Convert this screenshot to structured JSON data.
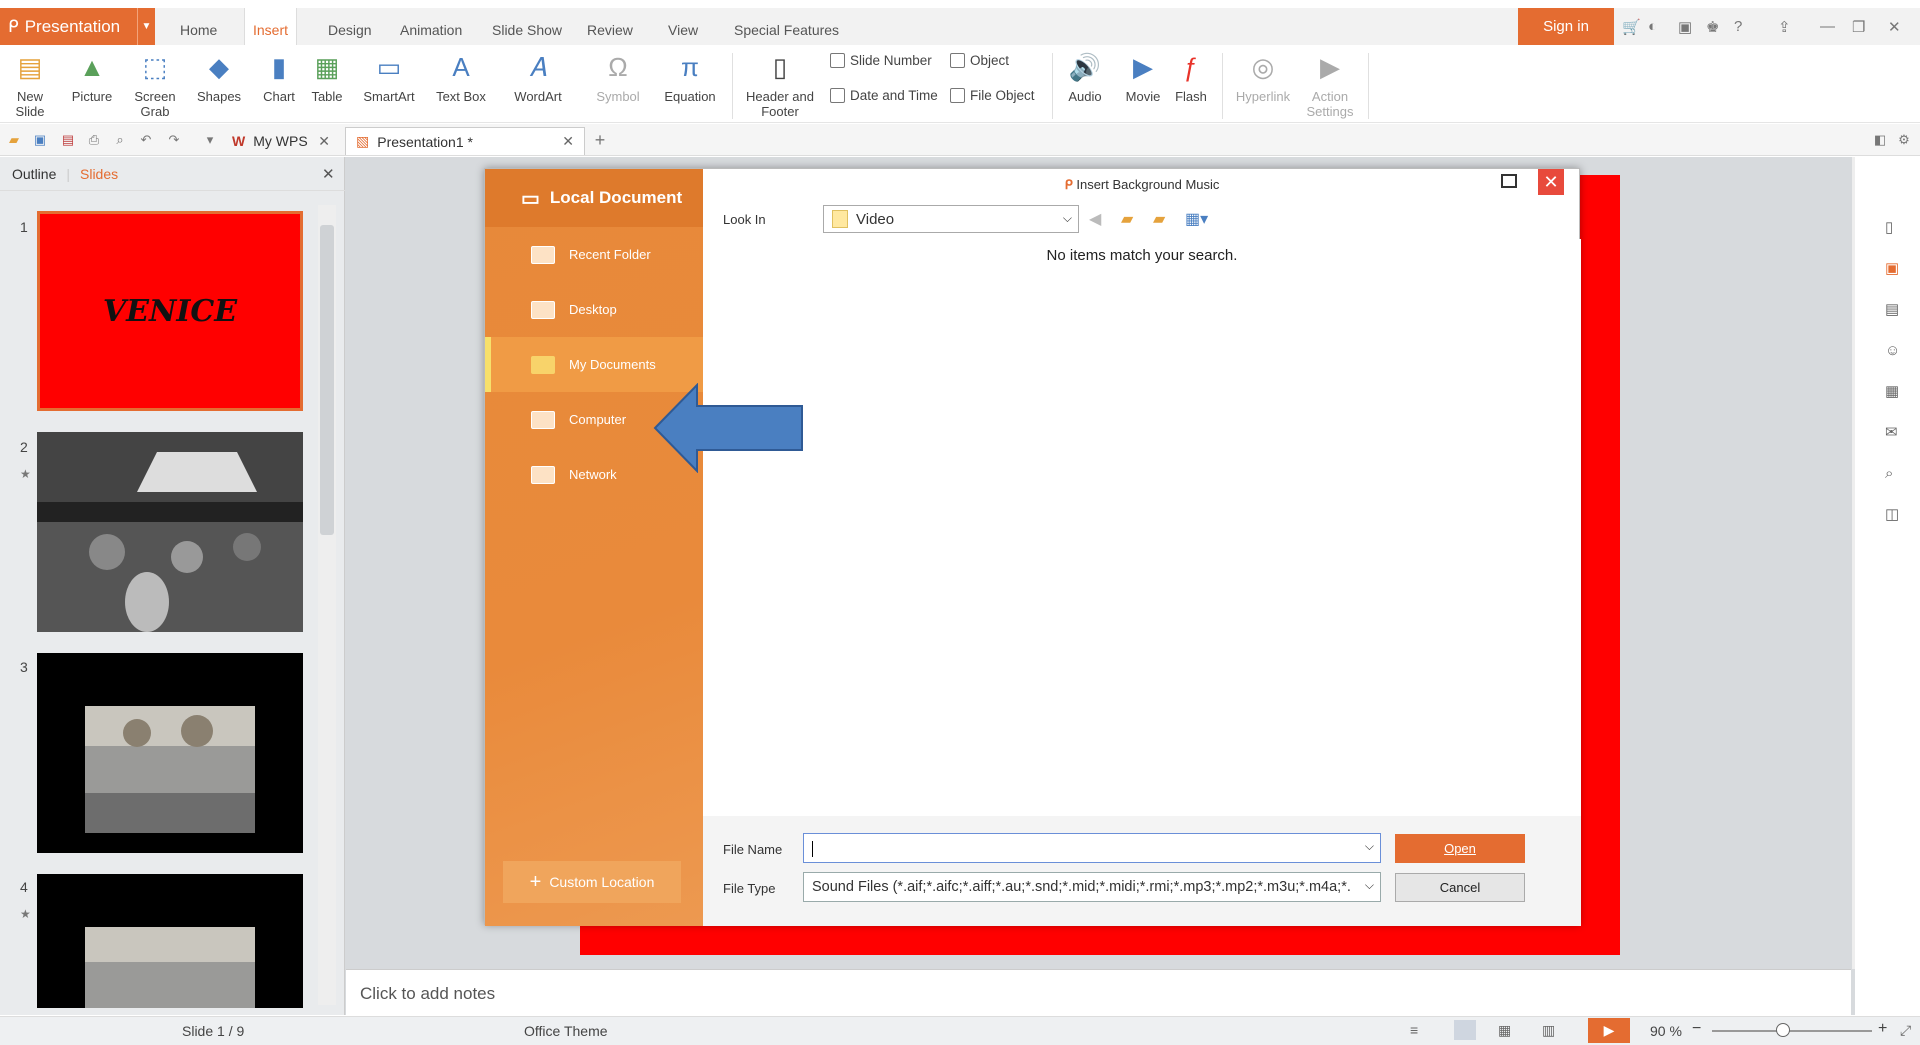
{
  "app": {
    "name": "Presentation",
    "sign_in": "Sign in"
  },
  "menu_tabs": [
    "Home",
    "Insert",
    "Design",
    "Animation",
    "Slide Show",
    "Review",
    "View",
    "Special Features"
  ],
  "ribbon": {
    "new_slide": "New\nSlide",
    "picture": "Picture",
    "screen_grab": "Screen\nGrab",
    "shapes": "Shapes",
    "chart": "Chart",
    "table": "Table",
    "smartart": "SmartArt",
    "text_box": "Text Box",
    "wordart": "WordArt",
    "symbol": "Symbol",
    "equation": "Equation",
    "header_footer": "Header and\nFooter",
    "slide_number": "Slide Number",
    "object": "Object",
    "date_time": "Date and Time",
    "file_object": "File Object",
    "audio": "Audio",
    "movie": "Movie",
    "flash": "Flash",
    "hyperlink": "Hyperlink",
    "action_settings": "Action\nSettings"
  },
  "doc_tabs": {
    "mywps": "My WPS",
    "presentation": "Presentation1 *"
  },
  "left_panel": {
    "outline": "Outline",
    "slides": "Slides",
    "slide1_text": "VENICE",
    "numbers": [
      "1",
      "2",
      "3",
      "4"
    ]
  },
  "notes_placeholder": "Click to add notes",
  "status": {
    "slide": "Slide 1 / 9",
    "theme": "Office Theme",
    "zoom": "90 %"
  },
  "dialog": {
    "title": "Insert Background Music",
    "header": "Local Document",
    "nav": [
      "Recent Folder",
      "Desktop",
      "My Documents",
      "Computer",
      "Network"
    ],
    "selected_nav": "My Documents",
    "custom_location": "Custom Location",
    "look_in_label": "Look In",
    "look_in_value": "Video",
    "empty_message": "No items match your search.",
    "file_name_label": "File Name",
    "file_name_value": "",
    "file_type_label": "File Type",
    "file_type_value": "Sound Files (*.aif;*.aifc;*.aiff;*.au;*.snd;*.mid;*.midi;*.rmi;*.mp3;*.mp2;*.m3u;*.m4a;*.",
    "open": "Open",
    "cancel": "Cancel"
  },
  "colors": {
    "accent": "#e46c31",
    "slide_bg": "#ff0000",
    "arrow": "#4a7fc1"
  }
}
